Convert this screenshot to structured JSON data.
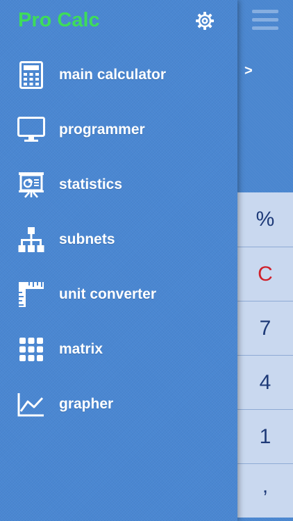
{
  "app": {
    "title": "Pro Calc",
    "title_color": "#3ddc5a"
  },
  "header": {
    "settings_icon": "gear-icon"
  },
  "menu": {
    "items": [
      {
        "label": "main calculator",
        "icon": "calculator-icon"
      },
      {
        "label": "programmer",
        "icon": "monitor-icon"
      },
      {
        "label": "statistics",
        "icon": "presentation-board-icon"
      },
      {
        "label": "subnets",
        "icon": "network-hierarchy-icon"
      },
      {
        "label": "unit converter",
        "icon": "ruler-icon"
      },
      {
        "label": "matrix",
        "icon": "grid-icon"
      },
      {
        "label": "grapher",
        "icon": "line-chart-icon"
      }
    ]
  },
  "peek": {
    "hamburger_icon": "hamburger-menu-icon",
    "chevron": ">",
    "keys": [
      {
        "label": "%",
        "color": "#1e3a78"
      },
      {
        "label": "C",
        "color": "#d0202a"
      },
      {
        "label": "7",
        "color": "#1e3a78"
      },
      {
        "label": "4",
        "color": "#1e3a78"
      },
      {
        "label": "1",
        "color": "#1e3a78"
      },
      {
        "label": ",",
        "color": "#1e3a78"
      }
    ]
  },
  "colors": {
    "drawer_background": "#4a87d2",
    "key_background": "#c9d8ef",
    "icon_color": "#ffffff"
  }
}
